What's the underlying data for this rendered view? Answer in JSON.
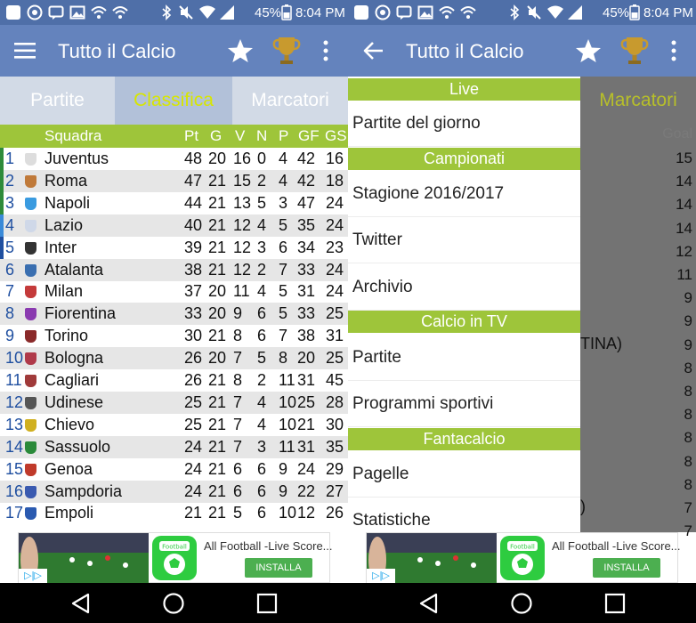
{
  "status": {
    "battery": "45%",
    "time": "8:04 PM"
  },
  "app_title": "Tutto il Calcio",
  "tabs": [
    "Partite",
    "Classifica",
    "Marcatori"
  ],
  "standings": {
    "headers": {
      "team": "Squadra",
      "pt": "Pt",
      "g": "G",
      "v": "V",
      "n": "N",
      "p": "P",
      "gf": "GF",
      "gs": "GS"
    },
    "rows": [
      {
        "pos": "1",
        "team": "Juventus",
        "pt": "48",
        "g": "20",
        "v": "16",
        "n": "0",
        "p": "4",
        "gf": "42",
        "gs": "16",
        "bar": "#2e8b3a",
        "crest": "#dddddd"
      },
      {
        "pos": "2",
        "team": "Roma",
        "pt": "47",
        "g": "21",
        "v": "15",
        "n": "2",
        "p": "4",
        "gf": "42",
        "gs": "18",
        "bar": "#2e8b3a",
        "crest": "#c07a3a"
      },
      {
        "pos": "3",
        "team": "Napoli",
        "pt": "44",
        "g": "21",
        "v": "13",
        "n": "5",
        "p": "3",
        "gf": "47",
        "gs": "24",
        "bar": "#2e8b3a",
        "crest": "#3a9be0"
      },
      {
        "pos": "4",
        "team": "Lazio",
        "pt": "40",
        "g": "21",
        "v": "12",
        "n": "4",
        "p": "5",
        "gf": "35",
        "gs": "24",
        "bar": "#3a8ad8",
        "crest": "#cfd8e8"
      },
      {
        "pos": "5",
        "team": "Inter",
        "pt": "39",
        "g": "21",
        "v": "12",
        "n": "3",
        "p": "6",
        "gf": "34",
        "gs": "23",
        "bar": "#1f4fa0",
        "crest": "#333333"
      },
      {
        "pos": "6",
        "team": "Atalanta",
        "pt": "38",
        "g": "21",
        "v": "12",
        "n": "2",
        "p": "7",
        "gf": "33",
        "gs": "24",
        "bar": "",
        "crest": "#3a6fb0"
      },
      {
        "pos": "7",
        "team": "Milan",
        "pt": "37",
        "g": "20",
        "v": "11",
        "n": "4",
        "p": "5",
        "gf": "31",
        "gs": "24",
        "bar": "",
        "crest": "#c43a3a"
      },
      {
        "pos": "8",
        "team": "Fiorentina",
        "pt": "33",
        "g": "20",
        "v": "9",
        "n": "6",
        "p": "5",
        "gf": "33",
        "gs": "25",
        "bar": "",
        "crest": "#8a3ab0"
      },
      {
        "pos": "9",
        "team": "Torino",
        "pt": "30",
        "g": "21",
        "v": "8",
        "n": "6",
        "p": "7",
        "gf": "38",
        "gs": "31",
        "bar": "",
        "crest": "#8a2a2a"
      },
      {
        "pos": "10",
        "team": "Bologna",
        "pt": "26",
        "g": "20",
        "v": "7",
        "n": "5",
        "p": "8",
        "gf": "20",
        "gs": "25",
        "bar": "",
        "crest": "#b03a4a"
      },
      {
        "pos": "11",
        "team": "Cagliari",
        "pt": "26",
        "g": "21",
        "v": "8",
        "n": "2",
        "p": "11",
        "gf": "31",
        "gs": "45",
        "bar": "",
        "crest": "#a03a3a"
      },
      {
        "pos": "12",
        "team": "Udinese",
        "pt": "25",
        "g": "21",
        "v": "7",
        "n": "4",
        "p": "10",
        "gf": "25",
        "gs": "28",
        "bar": "",
        "crest": "#555555"
      },
      {
        "pos": "13",
        "team": "Chievo",
        "pt": "25",
        "g": "21",
        "v": "7",
        "n": "4",
        "p": "10",
        "gf": "21",
        "gs": "30",
        "bar": "",
        "crest": "#d0b020"
      },
      {
        "pos": "14",
        "team": "Sassuolo",
        "pt": "24",
        "g": "21",
        "v": "7",
        "n": "3",
        "p": "11",
        "gf": "31",
        "gs": "35",
        "bar": "",
        "crest": "#2a8a3a"
      },
      {
        "pos": "15",
        "team": "Genoa",
        "pt": "24",
        "g": "21",
        "v": "6",
        "n": "6",
        "p": "9",
        "gf": "24",
        "gs": "29",
        "bar": "",
        "crest": "#c03a2a"
      },
      {
        "pos": "16",
        "team": "Sampdoria",
        "pt": "24",
        "g": "21",
        "v": "6",
        "n": "6",
        "p": "9",
        "gf": "22",
        "gs": "27",
        "bar": "",
        "crest": "#3a5ab0"
      },
      {
        "pos": "17",
        "team": "Empoli",
        "pt": "21",
        "g": "21",
        "v": "5",
        "n": "6",
        "p": "10",
        "gf": "12",
        "gs": "26",
        "bar": "",
        "crest": "#2a5ab0"
      }
    ]
  },
  "ad": {
    "app_name": "All Football -Live Score...",
    "install": "INSTALLA",
    "logo_text": "Football"
  },
  "drawer": {
    "sections": [
      "Live",
      "Campionati",
      "Calcio in TV",
      "Fantacalcio"
    ],
    "items": [
      "Partite del giorno",
      "Stagione 2016/2017",
      "Twitter",
      "Archivio",
      "Partite",
      "Programmi sportivi",
      "Pagelle",
      "Statistiche"
    ]
  },
  "behind": {
    "tab": "Marcatori",
    "goal_header": "Goal",
    "goals": [
      "15",
      "14",
      "14",
      "14",
      "12",
      "11",
      "9",
      "9",
      "9",
      "8",
      "8",
      "8",
      "8",
      "8",
      "8",
      "7",
      "7"
    ],
    "fragment_tina": "TINA)",
    "fragment_paren": ")"
  },
  "colors": {
    "primary": "#6483bd",
    "status": "#4f6fa8",
    "accent": "#9ec53a",
    "active_tab_text": "#d7e600"
  }
}
